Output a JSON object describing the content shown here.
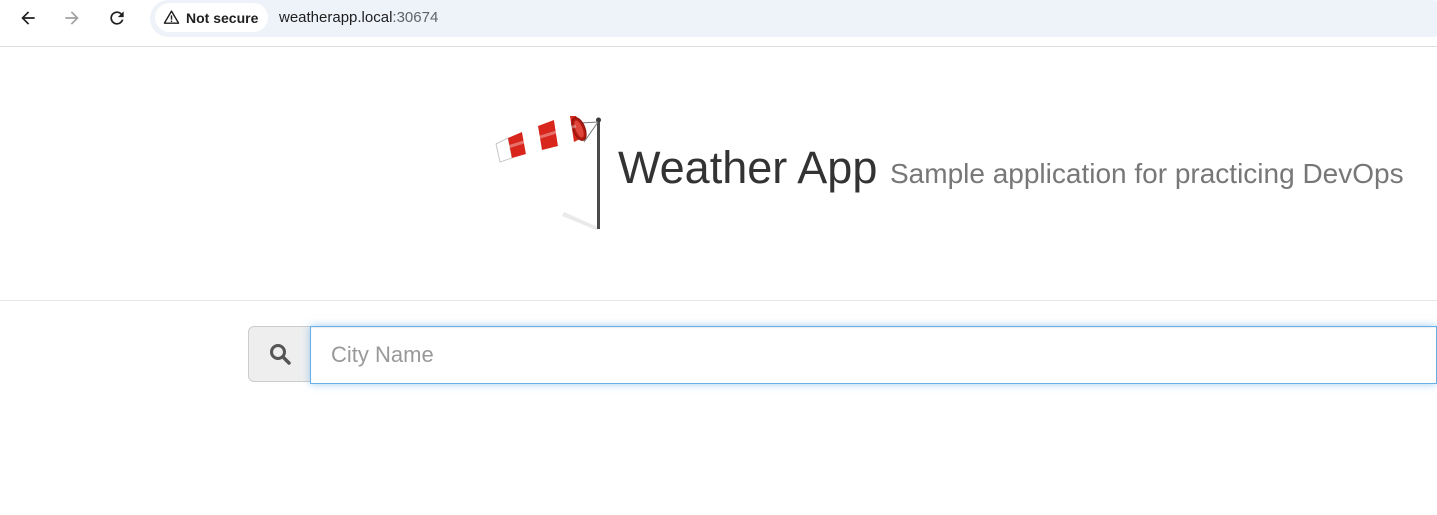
{
  "browser": {
    "back_icon": "arrow-left-icon",
    "forward_icon": "arrow-right-icon",
    "reload_icon": "reload-icon",
    "security_label": "Not secure",
    "security_icon": "warning-triangle-icon",
    "url_host": "weatherapp.local",
    "url_port": ":30674"
  },
  "header": {
    "logo_icon": "windsock-icon",
    "title": "Weather App",
    "subtitle": "Sample application for practicing DevOps"
  },
  "search": {
    "icon": "search-icon",
    "placeholder": "City Name",
    "value": ""
  },
  "colors": {
    "focus_border": "#66afe9",
    "windsock_red": "#d9261c",
    "title_text": "#333333",
    "subtitle_text": "#777777"
  }
}
